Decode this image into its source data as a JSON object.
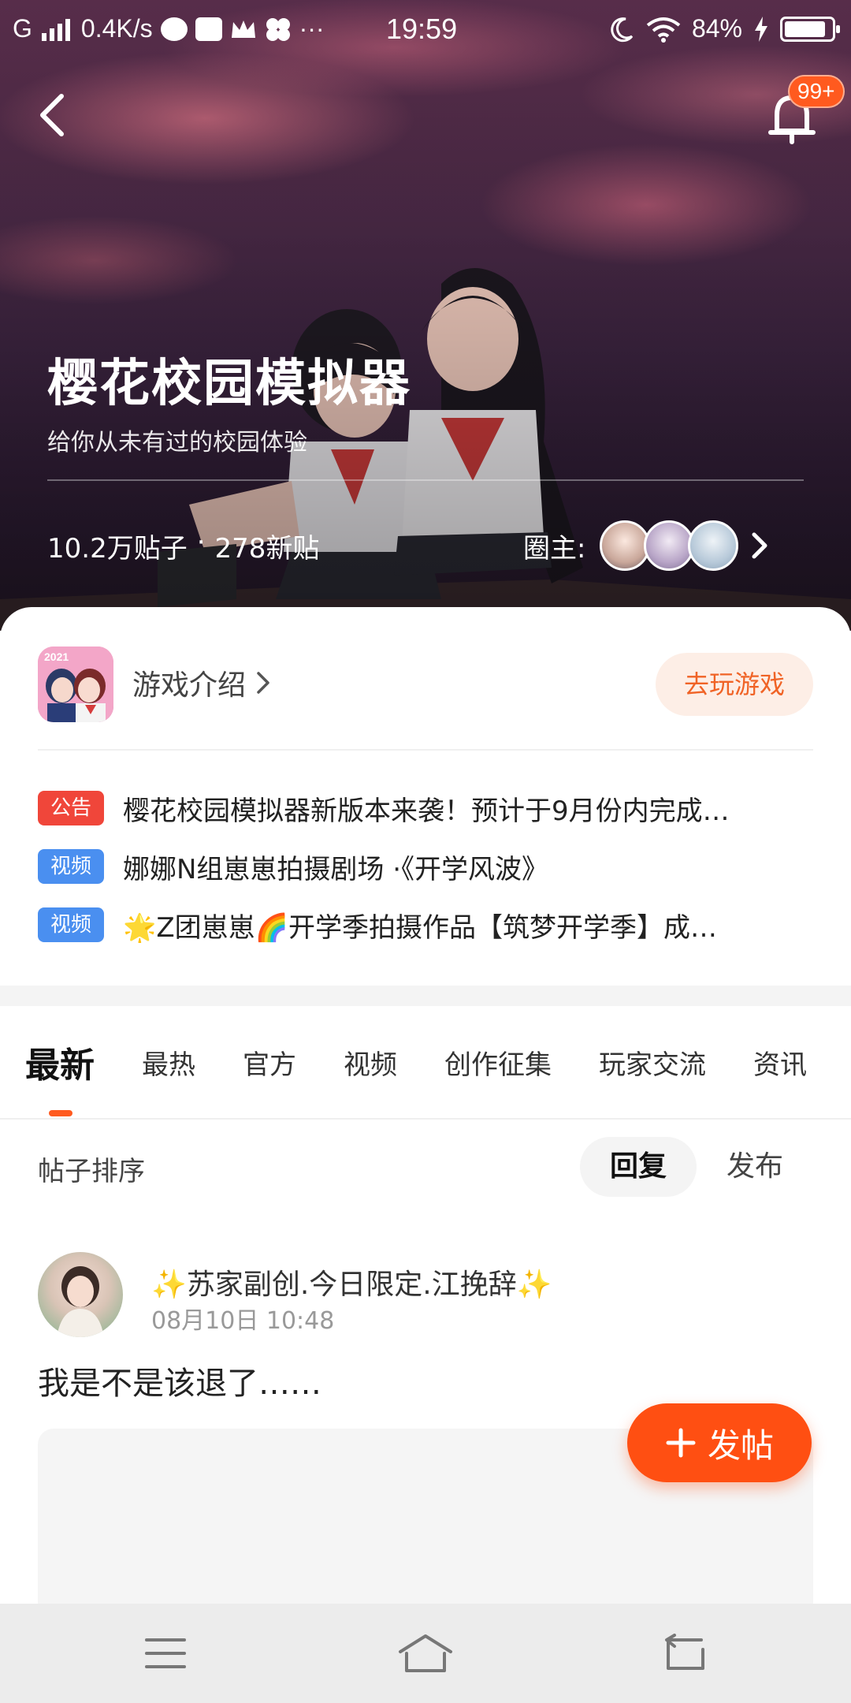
{
  "status_bar": {
    "network": "G",
    "speed": "0.4K/s",
    "more": "···",
    "time": "19:59",
    "battery": "84%"
  },
  "header": {
    "notification_badge": "99+"
  },
  "game": {
    "title": "樱花校园模拟器",
    "subtitle": "给你从未有过的校园体验",
    "posts_count": "10.2万贴子",
    "stats_sep": "·",
    "new_posts": "278新贴",
    "owners_label": "圈主:",
    "intro_label": "游戏介绍",
    "play_label": "去玩游戏",
    "icon_year": "2021"
  },
  "notices": [
    {
      "tag": "公告",
      "tag_color": "#f0463a",
      "text": "樱花校园模拟器新版本来袭！预计于9月份内完成…"
    },
    {
      "tag": "视频",
      "tag_color": "#4a8ff0",
      "text": "娜娜N组崽崽拍摄剧场 ·《开学风波》"
    },
    {
      "tag": "视频",
      "tag_color": "#4a8ff0",
      "text": "🌟Z团崽崽🌈开学季拍摄作品【筑梦开学季】成…"
    }
  ],
  "tabs": [
    "最新",
    "最热",
    "官方",
    "视频",
    "创作征集",
    "玩家交流",
    "资讯"
  ],
  "sort": {
    "label": "帖子排序",
    "options": [
      "回复",
      "发布"
    ],
    "selected": "回复"
  },
  "post": {
    "author": "✨苏家副创.今日限定.江挽辞✨",
    "time": "08月10日 10:48",
    "text": "我是不是该退了……"
  },
  "fab": {
    "label": "发帖"
  },
  "colors": {
    "accent": "#ff5a1f",
    "announce_tag": "#f0463a",
    "video_tag": "#4a8ff0"
  }
}
